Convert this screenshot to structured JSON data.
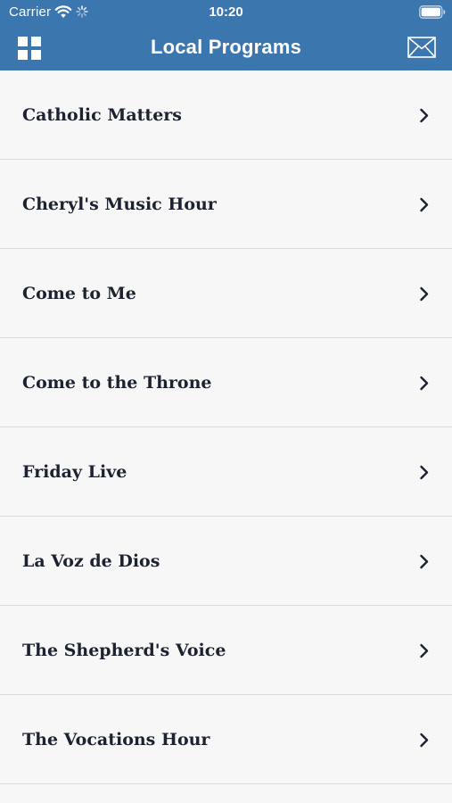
{
  "status_bar": {
    "carrier": "Carrier",
    "time": "10:20"
  },
  "nav": {
    "title": "Local Programs",
    "left_icon": "grid-menu-icon",
    "right_icon": "mail-icon"
  },
  "programs": [
    {
      "label": "Catholic Matters"
    },
    {
      "label": "Cheryl's Music Hour"
    },
    {
      "label": "Come to Me"
    },
    {
      "label": "Come to the Throne"
    },
    {
      "label": "Friday Live"
    },
    {
      "label": "La Voz de Dios"
    },
    {
      "label": "The Shepherd's Voice"
    },
    {
      "label": "The Vocations Hour"
    }
  ],
  "colors": {
    "header": "#3c76ae",
    "background": "#f7f7f8",
    "text": "#1c2330",
    "divider": "#dcdcde"
  }
}
